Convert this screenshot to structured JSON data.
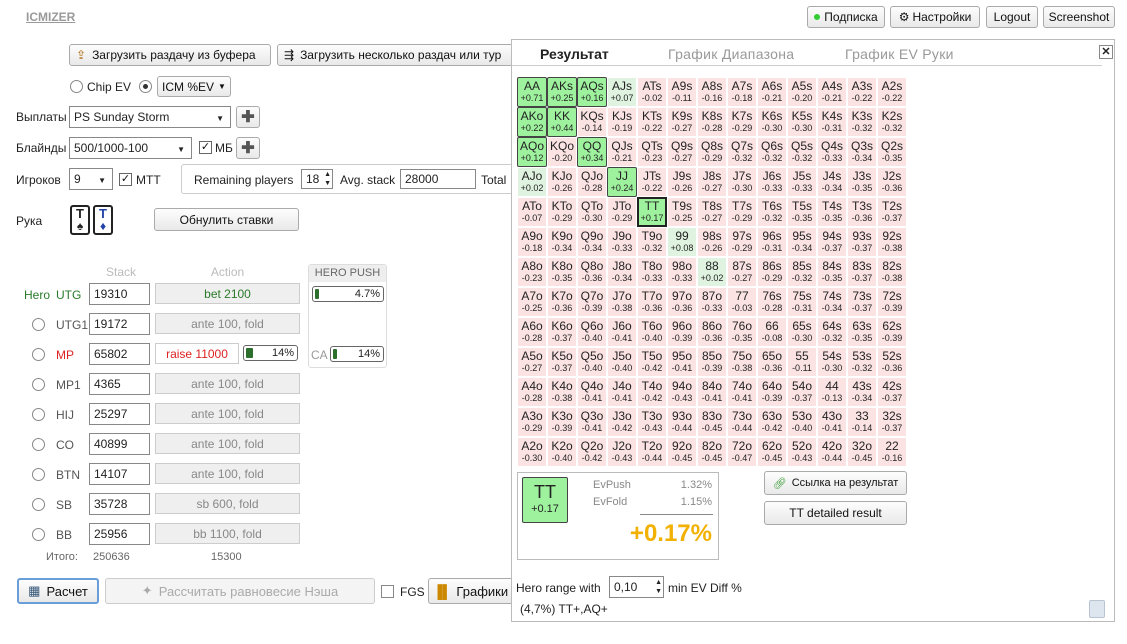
{
  "app": {
    "logo": "ICMIZER"
  },
  "topbar": {
    "subscription": "Подписка",
    "settings": "Настройки",
    "logout": "Logout",
    "screenshot": "Screenshot"
  },
  "toolbar": {
    "load_hand": "Загрузить раздачу из буфера",
    "load_many": "Загрузить несколько раздач или тур"
  },
  "mode": {
    "chip_ev": "Chip EV",
    "icm": "ICM %EV"
  },
  "form": {
    "payouts_label": "Выплаты",
    "payouts_value": "PS Sunday Storm",
    "blinds_label": "Блайнды",
    "blinds_value": "500/1000-100",
    "mb_label": "МБ",
    "players_label": "Игроков",
    "players_value": "9",
    "mtt_label": "МТТ",
    "remaining_label": "Remaining players",
    "remaining_value": "18",
    "avg_label": "Avg. stack",
    "avg_value": "28000",
    "total_label": "Total",
    "hand_label": "Рука",
    "reset_bets": "Обнулить ставки",
    "card1": "T",
    "card2": "T"
  },
  "table": {
    "stack_header": "Stack",
    "action_header": "Action",
    "hero_push_header": "HERO PUSH",
    "hero_push_value": "4.7%",
    "ca_label": "CA",
    "ca_value": "14%",
    "raise_pct": "14%",
    "total_label": "Итого:",
    "total_stack": "250636",
    "total_pot": "15300",
    "rows": [
      {
        "pos": "UTG",
        "stack": "19310",
        "action": "bet 2100",
        "hero": "Hero"
      },
      {
        "pos": "UTG1",
        "stack": "19172",
        "action": "ante 100, fold"
      },
      {
        "pos": "MP",
        "stack": "65802",
        "action": "raise 11000"
      },
      {
        "pos": "MP1",
        "stack": "4365",
        "action": "ante 100, fold"
      },
      {
        "pos": "HIJ",
        "stack": "25297",
        "action": "ante 100, fold"
      },
      {
        "pos": "CO",
        "stack": "40899",
        "action": "ante 100, fold"
      },
      {
        "pos": "BTN",
        "stack": "14107",
        "action": "ante 100, fold"
      },
      {
        "pos": "SB",
        "stack": "35728",
        "action": "sb 600, fold"
      },
      {
        "pos": "BB",
        "stack": "25956",
        "action": "bb 1100, fold"
      }
    ]
  },
  "bottom": {
    "calc": "Расчет",
    "nash": "Рассчитать равновесие Нэша",
    "fgs": "FGS",
    "charts": "Графики"
  },
  "result": {
    "tabs": [
      "Результат",
      "График Диапазона",
      "График EV Руки"
    ],
    "hand": "TT",
    "hand_ev": "+0.17",
    "evpush_label": "EvPush",
    "evpush": "1.32%",
    "evfold_label": "EvFold",
    "evfold": "1.15%",
    "big_ev": "+0.17%",
    "link": "Ссылка на результат",
    "detailed": "TT detailed result",
    "range_label": "Hero range with",
    "range_value": "0,10",
    "range_suffix": "min EV Diff %",
    "range_text": "(4,7%) TT+,AQ+"
  },
  "grid": [
    [
      "AA",
      "+0.71"
    ],
    [
      "AKs",
      "+0.25"
    ],
    [
      "AQs",
      "+0.16"
    ],
    [
      "AJs",
      "+0.07"
    ],
    [
      "ATs",
      "-0.02"
    ],
    [
      "A9s",
      "-0.11"
    ],
    [
      "A8s",
      "-0.16"
    ],
    [
      "A7s",
      "-0.18"
    ],
    [
      "A6s",
      "-0.21"
    ],
    [
      "A5s",
      "-0.20"
    ],
    [
      "A4s",
      "-0.21"
    ],
    [
      "A3s",
      "-0.22"
    ],
    [
      "A2s",
      "-0.22"
    ],
    [
      "AKo",
      "+0.22"
    ],
    [
      "KK",
      "+0.44"
    ],
    [
      "KQs",
      "-0.14"
    ],
    [
      "KJs",
      "-0.19"
    ],
    [
      "KTs",
      "-0.22"
    ],
    [
      "K9s",
      "-0.27"
    ],
    [
      "K8s",
      "-0.28"
    ],
    [
      "K7s",
      "-0.29"
    ],
    [
      "K6s",
      "-0.30"
    ],
    [
      "K5s",
      "-0.30"
    ],
    [
      "K4s",
      "-0.31"
    ],
    [
      "K3s",
      "-0.32"
    ],
    [
      "K2s",
      "-0.32"
    ],
    [
      "AQo",
      "+0.12"
    ],
    [
      "KQo",
      "-0.20"
    ],
    [
      "QQ",
      "+0.34"
    ],
    [
      "QJs",
      "-0.21"
    ],
    [
      "QTs",
      "-0.23"
    ],
    [
      "Q9s",
      "-0.27"
    ],
    [
      "Q8s",
      "-0.29"
    ],
    [
      "Q7s",
      "-0.32"
    ],
    [
      "Q6s",
      "-0.32"
    ],
    [
      "Q5s",
      "-0.32"
    ],
    [
      "Q4s",
      "-0.33"
    ],
    [
      "Q3s",
      "-0.34"
    ],
    [
      "Q2s",
      "-0.35"
    ],
    [
      "AJo",
      "+0.02"
    ],
    [
      "KJo",
      "-0.26"
    ],
    [
      "QJo",
      "-0.28"
    ],
    [
      "JJ",
      "+0.24"
    ],
    [
      "JTs",
      "-0.22"
    ],
    [
      "J9s",
      "-0.26"
    ],
    [
      "J8s",
      "-0.27"
    ],
    [
      "J7s",
      "-0.30"
    ],
    [
      "J6s",
      "-0.33"
    ],
    [
      "J5s",
      "-0.33"
    ],
    [
      "J4s",
      "-0.34"
    ],
    [
      "J3s",
      "-0.35"
    ],
    [
      "J2s",
      "-0.36"
    ],
    [
      "ATo",
      "-0.07"
    ],
    [
      "KTo",
      "-0.29"
    ],
    [
      "QTo",
      "-0.30"
    ],
    [
      "JTo",
      "-0.29"
    ],
    [
      "TT",
      "+0.17"
    ],
    [
      "T9s",
      "-0.25"
    ],
    [
      "T8s",
      "-0.27"
    ],
    [
      "T7s",
      "-0.29"
    ],
    [
      "T6s",
      "-0.32"
    ],
    [
      "T5s",
      "-0.35"
    ],
    [
      "T4s",
      "-0.35"
    ],
    [
      "T3s",
      "-0.36"
    ],
    [
      "T2s",
      "-0.37"
    ],
    [
      "A9o",
      "-0.18"
    ],
    [
      "K9o",
      "-0.34"
    ],
    [
      "Q9o",
      "-0.34"
    ],
    [
      "J9o",
      "-0.33"
    ],
    [
      "T9o",
      "-0.32"
    ],
    [
      "99",
      "+0.08"
    ],
    [
      "98s",
      "-0.26"
    ],
    [
      "97s",
      "-0.29"
    ],
    [
      "96s",
      "-0.31"
    ],
    [
      "95s",
      "-0.34"
    ],
    [
      "94s",
      "-0.37"
    ],
    [
      "93s",
      "-0.37"
    ],
    [
      "92s",
      "-0.38"
    ],
    [
      "A8o",
      "-0.23"
    ],
    [
      "K8o",
      "-0.35"
    ],
    [
      "Q8o",
      "-0.36"
    ],
    [
      "J8o",
      "-0.34"
    ],
    [
      "T8o",
      "-0.33"
    ],
    [
      "98o",
      "-0.33"
    ],
    [
      "88",
      "+0.02"
    ],
    [
      "87s",
      "-0.27"
    ],
    [
      "86s",
      "-0.29"
    ],
    [
      "85s",
      "-0.32"
    ],
    [
      "84s",
      "-0.35"
    ],
    [
      "83s",
      "-0.37"
    ],
    [
      "82s",
      "-0.38"
    ],
    [
      "A7o",
      "-0.25"
    ],
    [
      "K7o",
      "-0.36"
    ],
    [
      "Q7o",
      "-0.39"
    ],
    [
      "J7o",
      "-0.38"
    ],
    [
      "T7o",
      "-0.36"
    ],
    [
      "97o",
      "-0.36"
    ],
    [
      "87o",
      "-0.33"
    ],
    [
      "77",
      "-0.03"
    ],
    [
      "76s",
      "-0.28"
    ],
    [
      "75s",
      "-0.31"
    ],
    [
      "74s",
      "-0.34"
    ],
    [
      "73s",
      "-0.37"
    ],
    [
      "72s",
      "-0.39"
    ],
    [
      "A6o",
      "-0.28"
    ],
    [
      "K6o",
      "-0.37"
    ],
    [
      "Q6o",
      "-0.40"
    ],
    [
      "J6o",
      "-0.41"
    ],
    [
      "T6o",
      "-0.40"
    ],
    [
      "96o",
      "-0.39"
    ],
    [
      "86o",
      "-0.36"
    ],
    [
      "76o",
      "-0.35"
    ],
    [
      "66",
      "-0.08"
    ],
    [
      "65s",
      "-0.30"
    ],
    [
      "64s",
      "-0.32"
    ],
    [
      "63s",
      "-0.35"
    ],
    [
      "62s",
      "-0.39"
    ],
    [
      "A5o",
      "-0.27"
    ],
    [
      "K5o",
      "-0.37"
    ],
    [
      "Q5o",
      "-0.40"
    ],
    [
      "J5o",
      "-0.40"
    ],
    [
      "T5o",
      "-0.42"
    ],
    [
      "95o",
      "-0.41"
    ],
    [
      "85o",
      "-0.39"
    ],
    [
      "75o",
      "-0.38"
    ],
    [
      "65o",
      "-0.36"
    ],
    [
      "55",
      "-0.11"
    ],
    [
      "54s",
      "-0.30"
    ],
    [
      "53s",
      "-0.32"
    ],
    [
      "52s",
      "-0.36"
    ],
    [
      "A4o",
      "-0.28"
    ],
    [
      "K4o",
      "-0.38"
    ],
    [
      "Q4o",
      "-0.41"
    ],
    [
      "J4o",
      "-0.41"
    ],
    [
      "T4o",
      "-0.42"
    ],
    [
      "94o",
      "-0.43"
    ],
    [
      "84o",
      "-0.41"
    ],
    [
      "74o",
      "-0.41"
    ],
    [
      "64o",
      "-0.39"
    ],
    [
      "54o",
      "-0.37"
    ],
    [
      "44",
      "-0.13"
    ],
    [
      "43s",
      "-0.34"
    ],
    [
      "42s",
      "-0.37"
    ],
    [
      "A3o",
      "-0.29"
    ],
    [
      "K3o",
      "-0.39"
    ],
    [
      "Q3o",
      "-0.41"
    ],
    [
      "J3o",
      "-0.42"
    ],
    [
      "T3o",
      "-0.43"
    ],
    [
      "93o",
      "-0.44"
    ],
    [
      "83o",
      "-0.45"
    ],
    [
      "73o",
      "-0.44"
    ],
    [
      "63o",
      "-0.42"
    ],
    [
      "53o",
      "-0.40"
    ],
    [
      "43o",
      "-0.41"
    ],
    [
      "33",
      "-0.14"
    ],
    [
      "32s",
      "-0.37"
    ],
    [
      "A2o",
      "-0.30"
    ],
    [
      "K2o",
      "-0.40"
    ],
    [
      "Q2o",
      "-0.42"
    ],
    [
      "J2o",
      "-0.43"
    ],
    [
      "T2o",
      "-0.44"
    ],
    [
      "92o",
      "-0.45"
    ],
    [
      "82o",
      "-0.45"
    ],
    [
      "72o",
      "-0.47"
    ],
    [
      "62o",
      "-0.45"
    ],
    [
      "52o",
      "-0.43"
    ],
    [
      "42o",
      "-0.44"
    ],
    [
      "32o",
      "-0.45"
    ],
    [
      "22",
      "-0.16"
    ]
  ]
}
